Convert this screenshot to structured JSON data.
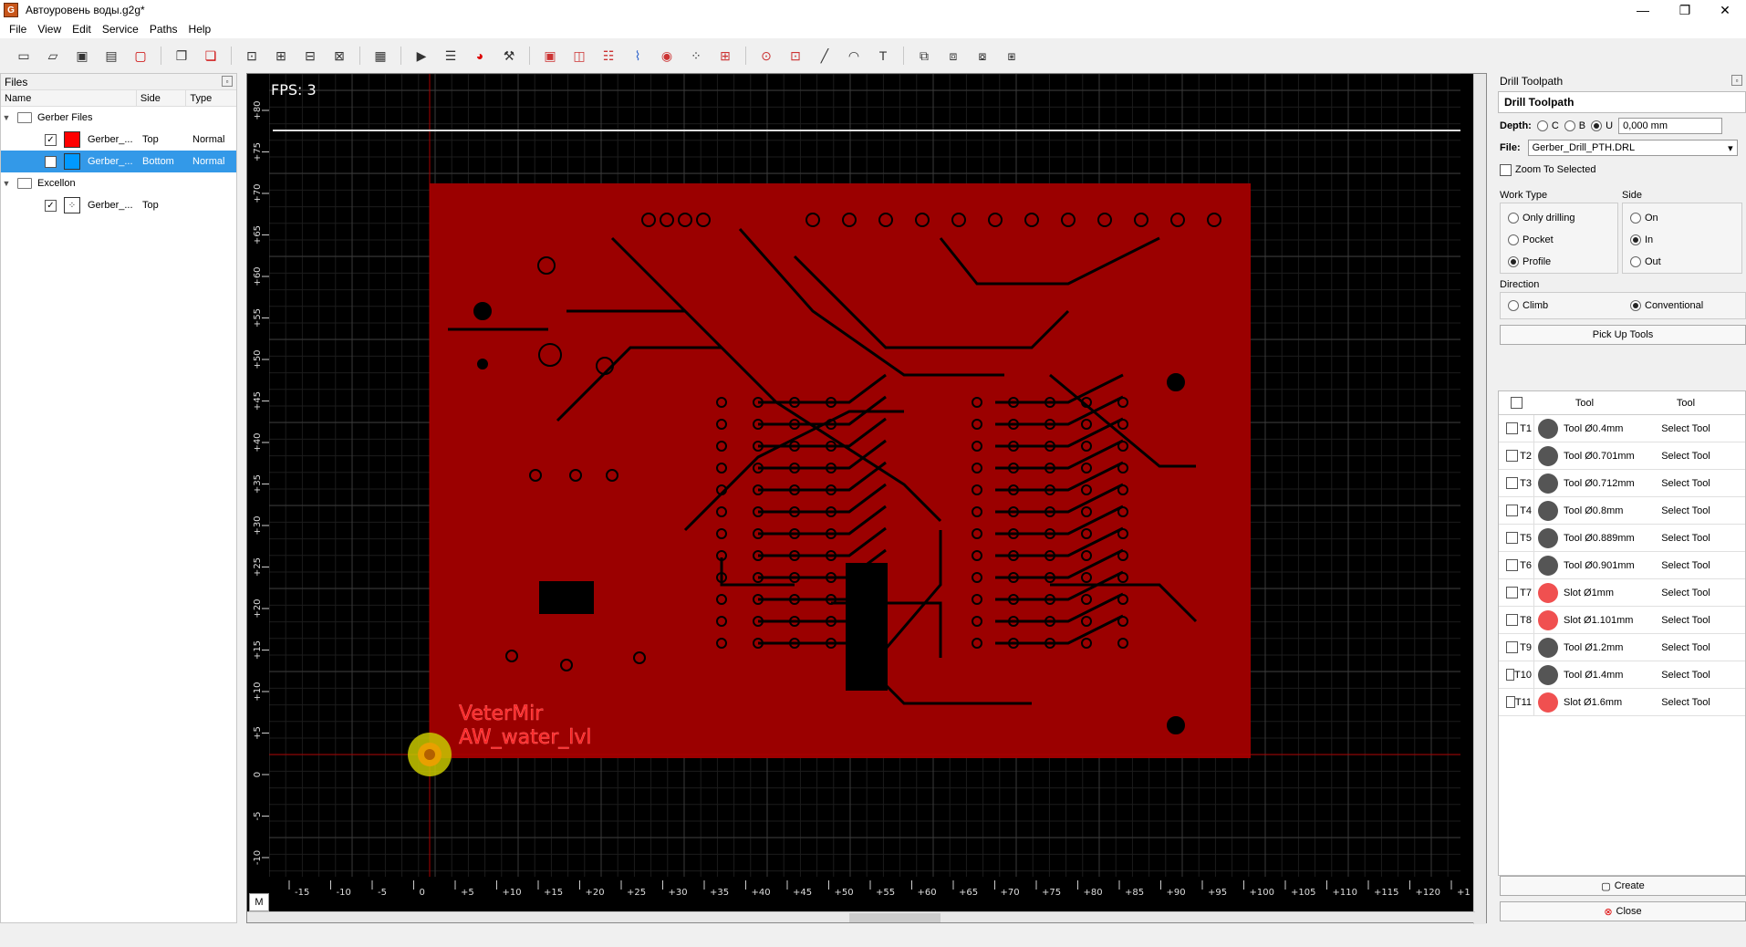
{
  "window": {
    "title": "Автоуровень воды.g2g*",
    "minimize": "—",
    "restore": "❐",
    "close": "✕"
  },
  "menu": [
    "File",
    "View",
    "Edit",
    "Service",
    "Paths",
    "Help"
  ],
  "files_panel": {
    "title": "Files",
    "columns": [
      "Name",
      "Side",
      "Type"
    ],
    "groups": [
      {
        "label": "Gerber Files",
        "items": [
          {
            "name": "Gerber_...",
            "side": "Top",
            "type": "Normal",
            "color": "#ff0000",
            "checked": true
          },
          {
            "name": "Gerber_...",
            "side": "Bottom",
            "type": "Normal",
            "color": "#0099ff",
            "checked": false
          }
        ]
      },
      {
        "label": "Excellon",
        "items": [
          {
            "name": "Gerber_...",
            "side": "Top",
            "type": "",
            "checked": true
          }
        ]
      }
    ]
  },
  "canvas": {
    "fps": "FPS: 3",
    "m_button": "M",
    "board_labels": [
      "VeterMir",
      "AW_water_lvl"
    ],
    "x_ticks": [
      "-15",
      "-10",
      "-5",
      "0",
      "+5",
      "+10",
      "+15",
      "+20",
      "+25",
      "+30",
      "+35",
      "+40",
      "+45",
      "+50",
      "+55",
      "+60",
      "+65",
      "+70",
      "+75",
      "+80",
      "+85",
      "+90",
      "+95",
      "+100",
      "+105",
      "+110",
      "+115",
      "+120",
      "+1"
    ],
    "y_ticks": [
      "+80",
      "+75",
      "+70",
      "+65",
      "+60",
      "+55",
      "+50",
      "+45",
      "+40",
      "+35",
      "+30",
      "+25",
      "+20",
      "+15",
      "+10",
      "+5",
      "0",
      "-5",
      "-10"
    ],
    "colors": {
      "board": "#9b0000",
      "background": "#000000",
      "grid": "#1e1e1e",
      "origin": "#ffcc00"
    }
  },
  "drill_panel": {
    "title": "Drill Toolpath",
    "header": "Drill Toolpath",
    "depth_label": "Depth:",
    "depth_options": [
      "C",
      "B",
      "U"
    ],
    "depth_selected": "U",
    "depth_value": "0,000 mm",
    "file_label": "File:",
    "file_value": "Gerber_Drill_PTH.DRL",
    "zoom_label": "Zoom To Selected",
    "work_type_label": "Work Type",
    "work_types": [
      "Only drilling",
      "Pocket",
      "Profile"
    ],
    "work_type_selected": "Profile",
    "side_label": "Side",
    "sides": [
      "On",
      "In",
      "Out"
    ],
    "side_selected": "In",
    "direction_label": "Direction",
    "directions": [
      "Climb",
      "Conventional"
    ],
    "direction_selected": "Conventional",
    "pickup_button": "Pick Up Tools",
    "table_headers": [
      "Tool",
      "Tool"
    ],
    "tools": [
      {
        "id": "T1",
        "name": "Tool Ø0.4mm",
        "action": "Select Tool",
        "kind": "tool"
      },
      {
        "id": "T2",
        "name": "Tool Ø0.701mm",
        "action": "Select Tool",
        "kind": "tool"
      },
      {
        "id": "T3",
        "name": "Tool Ø0.712mm",
        "action": "Select Tool",
        "kind": "tool"
      },
      {
        "id": "T4",
        "name": "Tool Ø0.8mm",
        "action": "Select Tool",
        "kind": "tool"
      },
      {
        "id": "T5",
        "name": "Tool Ø0.889mm",
        "action": "Select Tool",
        "kind": "tool"
      },
      {
        "id": "T6",
        "name": "Tool Ø0.901mm",
        "action": "Select Tool",
        "kind": "tool"
      },
      {
        "id": "T7",
        "name": "Slot Ø1mm",
        "action": "Select Tool",
        "kind": "slot"
      },
      {
        "id": "T8",
        "name": "Slot Ø1.101mm",
        "action": "Select Tool",
        "kind": "slot"
      },
      {
        "id": "T9",
        "name": "Tool Ø1.2mm",
        "action": "Select Tool",
        "kind": "tool"
      },
      {
        "id": "T10",
        "name": "Tool Ø1.4mm",
        "action": "Select Tool",
        "kind": "tool"
      },
      {
        "id": "T11",
        "name": "Slot Ø1.6mm",
        "action": "Select Tool",
        "kind": "slot"
      }
    ],
    "create_button": "Create",
    "close_button": "Close"
  }
}
